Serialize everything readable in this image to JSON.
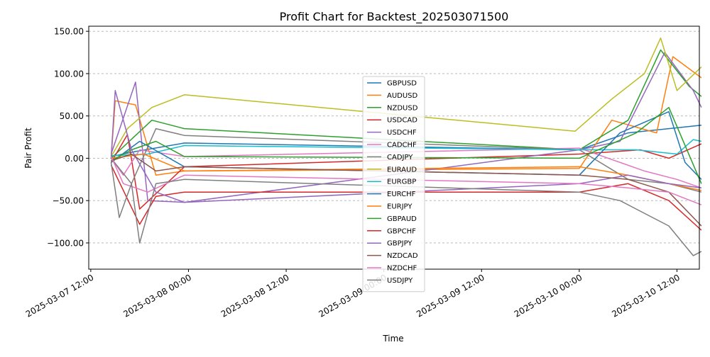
{
  "chart_data": {
    "type": "line",
    "title": "Profit Chart for Backtest_202503071500",
    "xlabel": "Time",
    "ylabel": "Pair Profit",
    "x_ticks": [
      "2025-03-07 12:00",
      "2025-03-08 00:00",
      "2025-03-08 12:00",
      "2025-03-09 00:00",
      "2025-03-09 12:00",
      "2025-03-10 00:00",
      "2025-03-10 12:00"
    ],
    "y_ticks": [
      "−100.00",
      "−50.00",
      "0.00",
      "50.00",
      "100.00",
      "150.00"
    ],
    "xlim": [
      "2025-03-07 11:45",
      "2025-03-10 14:45"
    ],
    "ylim": [
      -131,
      156
    ],
    "grid": {
      "x": false,
      "y": true
    },
    "legend_position": "center",
    "series": [
      {
        "name": "GBPUSD",
        "color": "#1f77b4",
        "points": [
          [
            "2025-03-07 14:30",
            2
          ],
          [
            "2025-03-07 17:30",
            8
          ],
          [
            "2025-03-07 23:30",
            18
          ],
          [
            "2025-03-10 00:00",
            10
          ],
          [
            "2025-03-10 06:00",
            30
          ],
          [
            "2025-03-10 11:00",
            35
          ],
          [
            "2025-03-10 15:00",
            39
          ]
        ]
      },
      {
        "name": "AUDUSD",
        "color": "#ff7f0e",
        "points": [
          [
            "2025-03-07 14:30",
            0
          ],
          [
            "2025-03-07 15:00",
            68
          ],
          [
            "2025-03-07 17:30",
            63
          ],
          [
            "2025-03-07 20:00",
            -20
          ],
          [
            "2025-03-07 23:30",
            -15
          ],
          [
            "2025-03-10 00:00",
            -12
          ],
          [
            "2025-03-10 04:00",
            45
          ],
          [
            "2025-03-10 09:30",
            30
          ],
          [
            "2025-03-10 11:30",
            120
          ],
          [
            "2025-03-10 15:00",
            95
          ]
        ]
      },
      {
        "name": "NZDUSD",
        "color": "#2ca02c",
        "points": [
          [
            "2025-03-07 14:30",
            0
          ],
          [
            "2025-03-07 19:30",
            45
          ],
          [
            "2025-03-07 23:30",
            35
          ],
          [
            "2025-03-10 00:00",
            10
          ],
          [
            "2025-03-10 06:00",
            45
          ],
          [
            "2025-03-10 10:00",
            128
          ],
          [
            "2025-03-10 13:30",
            85
          ],
          [
            "2025-03-10 15:00",
            73
          ]
        ]
      },
      {
        "name": "USDCAD",
        "color": "#d62728",
        "points": [
          [
            "2025-03-07 14:30",
            -5
          ],
          [
            "2025-03-07 16:30",
            28
          ],
          [
            "2025-03-07 18:00",
            -60
          ],
          [
            "2025-03-07 23:30",
            -10
          ],
          [
            "2025-03-10 00:00",
            5
          ],
          [
            "2025-03-10 07:30",
            10
          ],
          [
            "2025-03-10 11:00",
            0
          ],
          [
            "2025-03-10 15:00",
            17
          ]
        ]
      },
      {
        "name": "USDCHF",
        "color": "#9467bd",
        "points": [
          [
            "2025-03-07 14:30",
            5
          ],
          [
            "2025-03-07 17:30",
            90
          ],
          [
            "2025-03-07 19:00",
            -50
          ],
          [
            "2025-03-07 23:30",
            -52
          ],
          [
            "2025-03-10 00:00",
            10
          ],
          [
            "2025-03-10 05:00",
            20
          ],
          [
            "2025-03-10 10:30",
            125
          ],
          [
            "2025-03-10 14:00",
            80
          ],
          [
            "2025-03-10 15:00",
            60
          ]
        ]
      },
      {
        "name": "CADCHF",
        "color": "#e377c2",
        "points": [
          [
            "2025-03-07 14:30",
            0
          ],
          [
            "2025-03-07 16:00",
            -20
          ],
          [
            "2025-03-07 18:00",
            10
          ],
          [
            "2025-03-07 23:30",
            2
          ],
          [
            "2025-03-10 00:00",
            12
          ],
          [
            "2025-03-10 08:00",
            -15
          ],
          [
            "2025-03-10 12:00",
            -25
          ],
          [
            "2025-03-10 15:00",
            -35
          ]
        ]
      },
      {
        "name": "CADJPY",
        "color": "#7f7f7f",
        "points": [
          [
            "2025-03-07 14:30",
            0
          ],
          [
            "2025-03-07 17:00",
            -30
          ],
          [
            "2025-03-07 20:00",
            35
          ],
          [
            "2025-03-07 23:30",
            27
          ],
          [
            "2025-03-10 00:00",
            10
          ],
          [
            "2025-03-10 06:00",
            -25
          ],
          [
            "2025-03-10 11:00",
            -30
          ],
          [
            "2025-03-10 15:00",
            -40
          ]
        ]
      },
      {
        "name": "EURAUD",
        "color": "#bcbd22",
        "points": [
          [
            "2025-03-07 14:30",
            2
          ],
          [
            "2025-03-07 16:30",
            35
          ],
          [
            "2025-03-07 19:30",
            60
          ],
          [
            "2025-03-07 23:30",
            75
          ],
          [
            "2025-03-09 23:30",
            32
          ],
          [
            "2025-03-10 04:00",
            70
          ],
          [
            "2025-03-10 08:00",
            100
          ],
          [
            "2025-03-10 10:00",
            142
          ],
          [
            "2025-03-10 12:00",
            80
          ],
          [
            "2025-03-10 15:00",
            108
          ]
        ]
      },
      {
        "name": "EURGBP",
        "color": "#17becf",
        "points": [
          [
            "2025-03-07 14:30",
            3
          ],
          [
            "2025-03-07 19:00",
            5
          ],
          [
            "2025-03-07 23:30",
            15
          ],
          [
            "2025-03-10 00:00",
            10
          ],
          [
            "2025-03-10 07:00",
            10
          ],
          [
            "2025-03-10 12:00",
            5
          ],
          [
            "2025-03-10 14:00",
            22
          ],
          [
            "2025-03-10 15:00",
            20
          ]
        ]
      },
      {
        "name": "EURCHF",
        "color": "#1f77b4",
        "points": [
          [
            "2025-03-07 14:30",
            -5
          ],
          [
            "2025-03-07 18:00",
            20
          ],
          [
            "2025-03-07 23:30",
            -10
          ],
          [
            "2025-03-10 00:00",
            -20
          ],
          [
            "2025-03-10 05:00",
            30
          ],
          [
            "2025-03-10 11:00",
            55
          ],
          [
            "2025-03-10 13:00",
            -5
          ],
          [
            "2025-03-10 15:00",
            -25
          ]
        ]
      },
      {
        "name": "EURJPY",
        "color": "#ff7f0e",
        "points": [
          [
            "2025-03-07 14:30",
            0
          ],
          [
            "2025-03-07 18:30",
            5
          ],
          [
            "2025-03-07 23:30",
            -15
          ],
          [
            "2025-03-10 00:00",
            -10
          ],
          [
            "2025-03-10 06:00",
            -20
          ],
          [
            "2025-03-10 11:00",
            -30
          ],
          [
            "2025-03-10 15:00",
            -38
          ]
        ]
      },
      {
        "name": "GBPAUD",
        "color": "#2ca02c",
        "points": [
          [
            "2025-03-07 14:30",
            -3
          ],
          [
            "2025-03-07 17:00",
            10
          ],
          [
            "2025-03-07 20:00",
            20
          ],
          [
            "2025-03-07 23:30",
            2
          ],
          [
            "2025-03-10 00:00",
            0
          ],
          [
            "2025-03-10 07:00",
            30
          ],
          [
            "2025-03-10 11:00",
            60
          ],
          [
            "2025-03-10 15:00",
            -30
          ]
        ]
      },
      {
        "name": "GBPCHF",
        "color": "#d62728",
        "points": [
          [
            "2025-03-07 14:30",
            -8
          ],
          [
            "2025-03-07 18:00",
            -78
          ],
          [
            "2025-03-07 20:00",
            -45
          ],
          [
            "2025-03-07 23:30",
            -40
          ],
          [
            "2025-03-10 00:00",
            -40
          ],
          [
            "2025-03-10 06:00",
            -30
          ],
          [
            "2025-03-10 11:00",
            -50
          ],
          [
            "2025-03-10 15:00",
            -85
          ]
        ]
      },
      {
        "name": "GBPJPY",
        "color": "#9467bd",
        "points": [
          [
            "2025-03-07 14:30",
            0
          ],
          [
            "2025-03-07 15:00",
            80
          ],
          [
            "2025-03-07 17:00",
            10
          ],
          [
            "2025-03-07 20:00",
            -40
          ],
          [
            "2025-03-07 23:30",
            -52
          ],
          [
            "2025-03-10 00:00",
            -30
          ],
          [
            "2025-03-10 06:00",
            -20
          ],
          [
            "2025-03-10 11:00",
            -30
          ],
          [
            "2025-03-10 15:00",
            -35
          ]
        ]
      },
      {
        "name": "NZDCAD",
        "color": "#8c564b",
        "points": [
          [
            "2025-03-07 14:30",
            -3
          ],
          [
            "2025-03-07 17:00",
            5
          ],
          [
            "2025-03-07 20:00",
            -15
          ],
          [
            "2025-03-07 23:30",
            -10
          ],
          [
            "2025-03-10 00:00",
            -20
          ],
          [
            "2025-03-10 06:00",
            -25
          ],
          [
            "2025-03-10 11:00",
            -40
          ],
          [
            "2025-03-10 15:00",
            -80
          ]
        ]
      },
      {
        "name": "NZDCHF",
        "color": "#e377c2",
        "points": [
          [
            "2025-03-07 14:30",
            2
          ],
          [
            "2025-03-07 16:00",
            -30
          ],
          [
            "2025-03-07 19:00",
            -40
          ],
          [
            "2025-03-07 23:30",
            -20
          ],
          [
            "2025-03-10 00:00",
            -30
          ],
          [
            "2025-03-10 06:00",
            -35
          ],
          [
            "2025-03-10 11:00",
            -40
          ],
          [
            "2025-03-10 15:00",
            -55
          ]
        ]
      },
      {
        "name": "USDJPY",
        "color": "#7f7f7f",
        "points": [
          [
            "2025-03-07 14:30",
            -5
          ],
          [
            "2025-03-07 15:30",
            -70
          ],
          [
            "2025-03-07 17:00",
            -30
          ],
          [
            "2025-03-07 18:00",
            -100
          ],
          [
            "2025-03-07 20:00",
            -30
          ],
          [
            "2025-03-07 23:30",
            -25
          ],
          [
            "2025-03-10 00:00",
            -40
          ],
          [
            "2025-03-10 05:00",
            -50
          ],
          [
            "2025-03-10 11:00",
            -80
          ],
          [
            "2025-03-10 14:00",
            -115
          ],
          [
            "2025-03-10 15:00",
            -110
          ]
        ]
      }
    ]
  }
}
